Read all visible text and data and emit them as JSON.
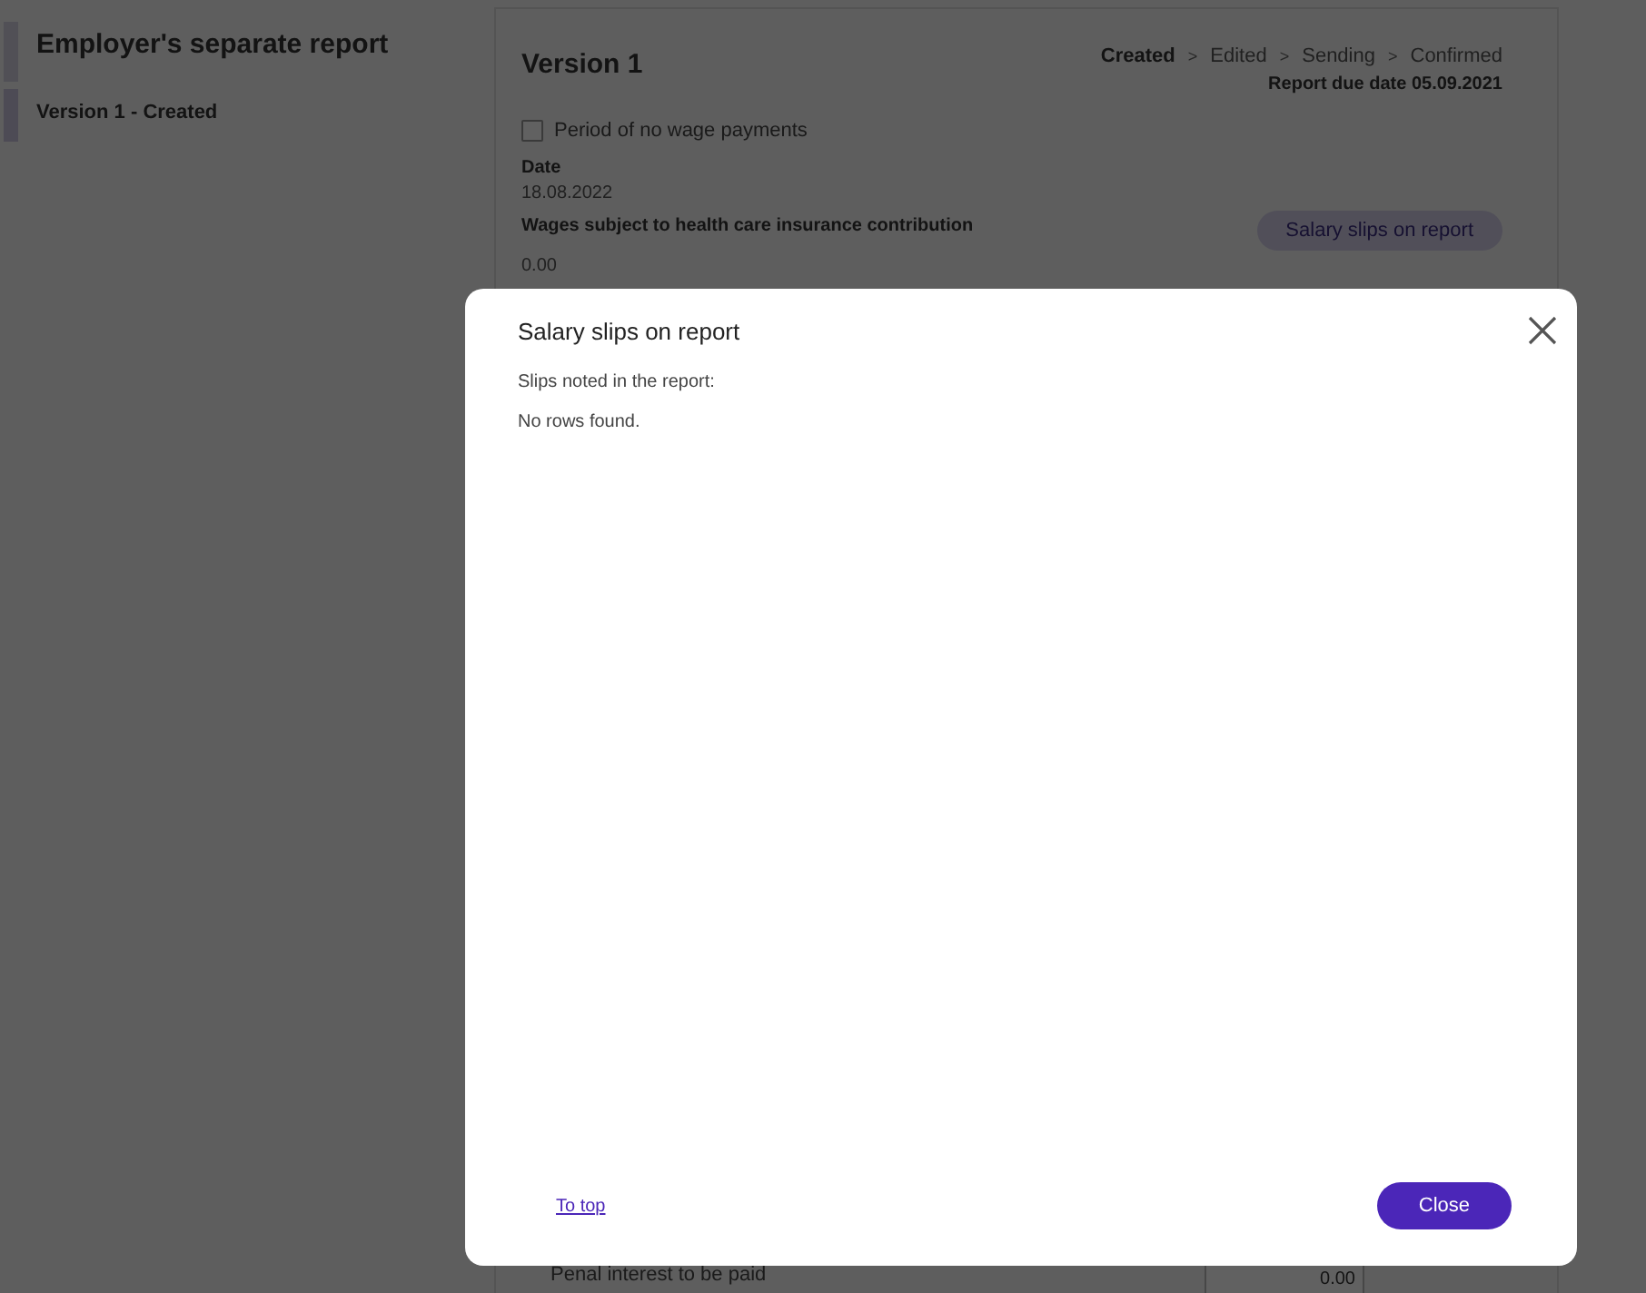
{
  "sidebar": {
    "title": "Employer's separate report",
    "items": [
      {
        "label": "Version 1 - Created",
        "selected": true
      }
    ]
  },
  "report": {
    "title": "Version 1",
    "steps": [
      {
        "label": "Created",
        "selected": true
      },
      {
        "label": "Edited",
        "selected": false
      },
      {
        "label": "Sending",
        "selected": false
      },
      {
        "label": "Confirmed",
        "selected": false
      }
    ],
    "separators": [
      ">",
      ">",
      ">"
    ],
    "due_date": "Report due date 05.09.2021",
    "no_wage_period": {
      "label": "Period of no wage payments",
      "checked": false
    },
    "date_label": "Date",
    "date_value": "18.08.2022",
    "wages_label": "Wages subject to health care insurance contribution",
    "wages_value": "0.00",
    "slips_button": "Salary slips on report",
    "penal_label": "Penal interest to be paid",
    "penal_value": "0.00"
  },
  "dialog": {
    "title": "Salary slips on report",
    "subtitle": "Slips noted in the report:",
    "empty": "No rows found.",
    "link": "To top",
    "close_button": "Close"
  }
}
